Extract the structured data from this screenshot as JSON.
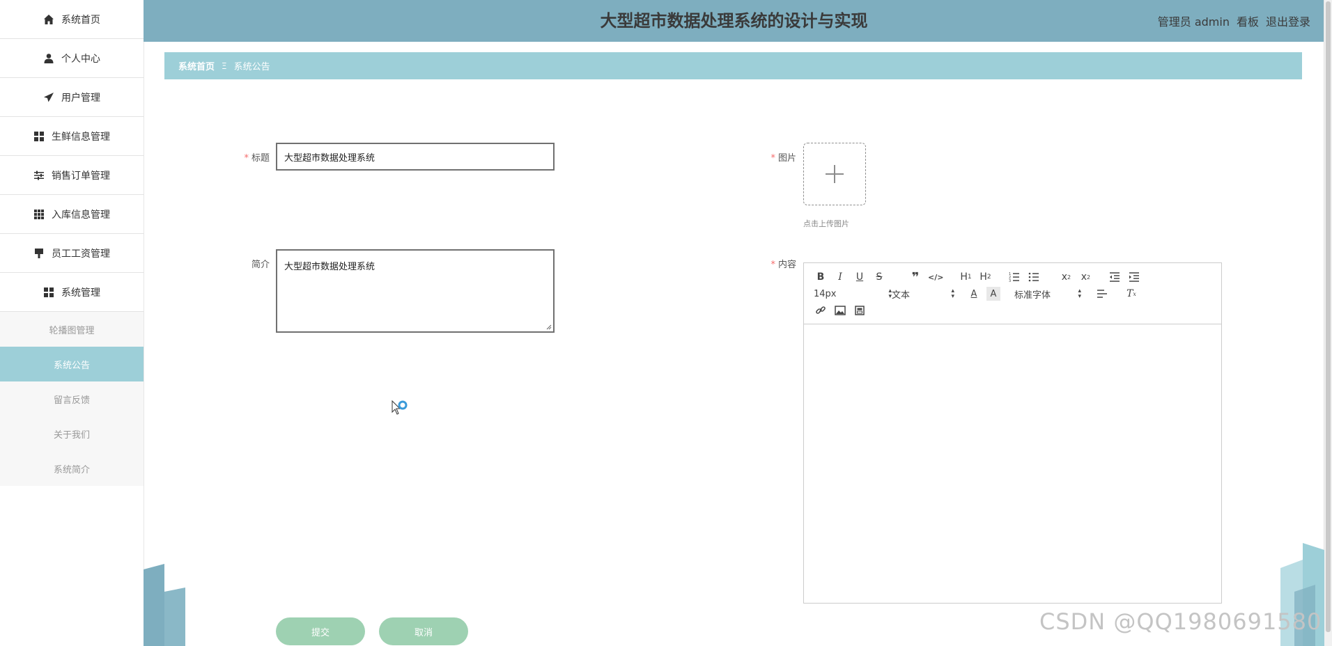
{
  "app": {
    "title": "大型超市数据处理系统的设计与实现",
    "user_label": "管理员 admin",
    "dashboard_link": "看板",
    "logout_link": "退出登录"
  },
  "sidebar": {
    "items": [
      {
        "label": "系统首页",
        "icon": "home-icon"
      },
      {
        "label": "个人中心",
        "icon": "user-icon"
      },
      {
        "label": "用户管理",
        "icon": "paper-plane-icon"
      },
      {
        "label": "生鲜信息管理",
        "icon": "grid-four-icon"
      },
      {
        "label": "销售订单管理",
        "icon": "sliders-icon"
      },
      {
        "label": "入库信息管理",
        "icon": "grid-nine-icon"
      },
      {
        "label": "员工工资管理",
        "icon": "brush-icon"
      },
      {
        "label": "系统管理",
        "icon": "grid-four-icon"
      }
    ],
    "subitems": [
      {
        "label": "轮播图管理"
      },
      {
        "label": "系统公告"
      },
      {
        "label": "留言反馈"
      },
      {
        "label": "关于我们"
      },
      {
        "label": "系统简介"
      }
    ],
    "active_subitem": "系统公告"
  },
  "breadcrumb": {
    "home": "系统首页",
    "separator": "Ξ",
    "current": "系统公告"
  },
  "form": {
    "title_label": "标题",
    "title_value": "大型超市数据处理系统",
    "intro_label": "简介",
    "intro_value": "大型超市数据处理系统",
    "image_label": "图片",
    "image_upload_hint": "点击上传图片",
    "content_label": "内容",
    "required_mark": "*",
    "submit_label": "提交",
    "cancel_label": "取消"
  },
  "editor": {
    "font_size": "14px",
    "header_select": "文本",
    "font_family": "标准字体"
  },
  "watermark": "CSDN @QQ1980691580",
  "colors": {
    "header_bg": "#7eaebf",
    "breadcrumb_bg": "#9dcfd8",
    "active_menu_bg": "#9dcfd8",
    "button_bg": "#9ed1b2",
    "required": "#f56c6c"
  }
}
